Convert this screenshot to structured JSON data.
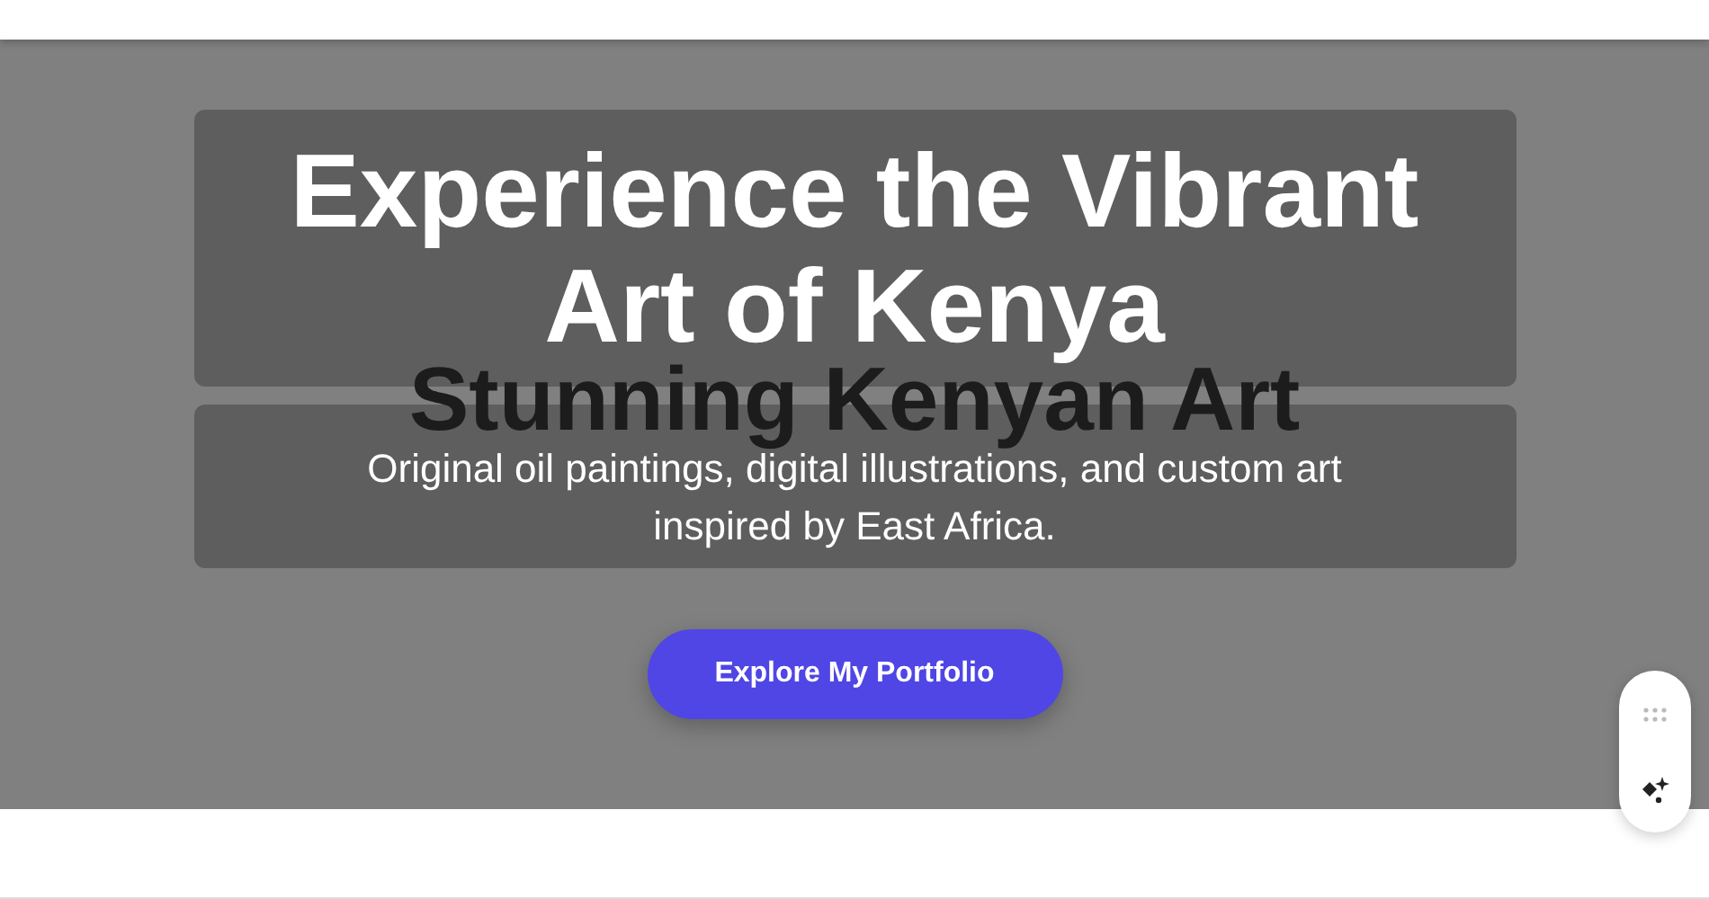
{
  "hero": {
    "title": "Experience the Vibrant Art of Kenya",
    "overlay_heading": "Stunning Kenyan Art",
    "subtitle": "Original oil paintings, digital illustrations, and custom art inspired by East Africa.",
    "button": "Explore My Portfolio"
  }
}
